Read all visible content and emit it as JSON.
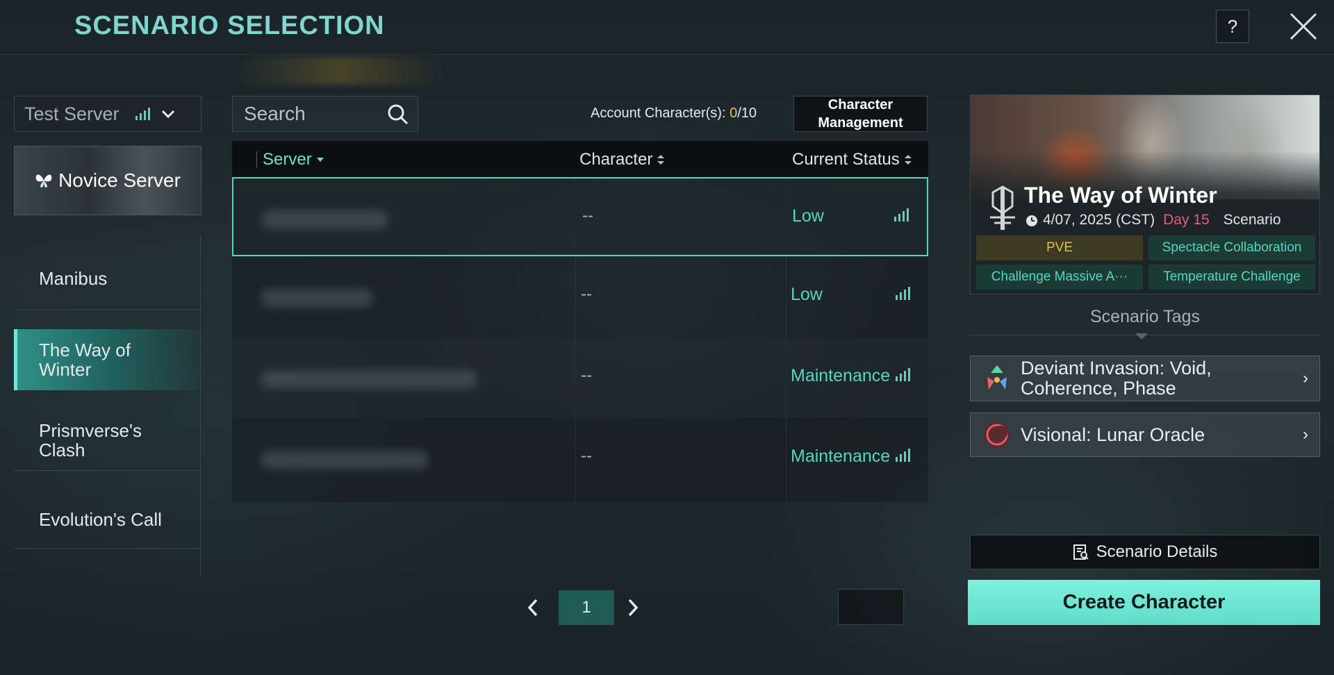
{
  "header": {
    "title": "SCENARIO SELECTION",
    "help_label": "?",
    "close_icon": "close-icon"
  },
  "colors": {
    "accent": "#56d6c2",
    "title": "#7fd6cf",
    "gold": "#e3c25a",
    "day_pink": "#e55c7a",
    "primary_button": "#6fe6d2"
  },
  "server_select": {
    "label": "Test Server",
    "icon": "signal-icon",
    "dropdown_icon": "chevron-down-icon"
  },
  "novice_server": {
    "label": "Novice Server",
    "icon": "butterfly-icon"
  },
  "scenarios": [
    {
      "label": "Manibus"
    },
    {
      "label": "The Way of Winter",
      "active": true
    },
    {
      "label": "Prismverse's Clash"
    },
    {
      "label": "Evolution's Call"
    }
  ],
  "search": {
    "placeholder": "Search"
  },
  "account": {
    "label": "Account Character(s): ",
    "current": "0",
    "separator": "/",
    "max": "10"
  },
  "character_management": {
    "line1": "Character",
    "line2": "Management"
  },
  "table": {
    "columns": [
      "Server",
      "Character",
      "Current Status"
    ],
    "rows": [
      {
        "character": "--",
        "status": "Low"
      },
      {
        "character": "--",
        "status": "Low"
      },
      {
        "character": "--",
        "status": "Maintenance"
      },
      {
        "character": "--",
        "status": "Maintenance"
      }
    ]
  },
  "pagination": {
    "current_page": "1"
  },
  "scenario_card": {
    "title": "The Way of Winter",
    "date": "4/07, 2025 (CST)",
    "day": "Day 15",
    "kind": "Scenario",
    "tags": [
      "PVE",
      "Spectacle Collaboration",
      "Challenge Massive A···",
      "Temperature Challenge"
    ]
  },
  "scenario_tags_label": "Scenario Tags",
  "features": [
    {
      "label": "Deviant Invasion: Void, Coherence, Phase",
      "icon": "deviant-icon"
    },
    {
      "label": "Visional: Lunar Oracle",
      "icon": "lunar-oracle-icon"
    }
  ],
  "buttons": {
    "scenario_details": "Scenario Details",
    "create_character": "Create Character"
  }
}
